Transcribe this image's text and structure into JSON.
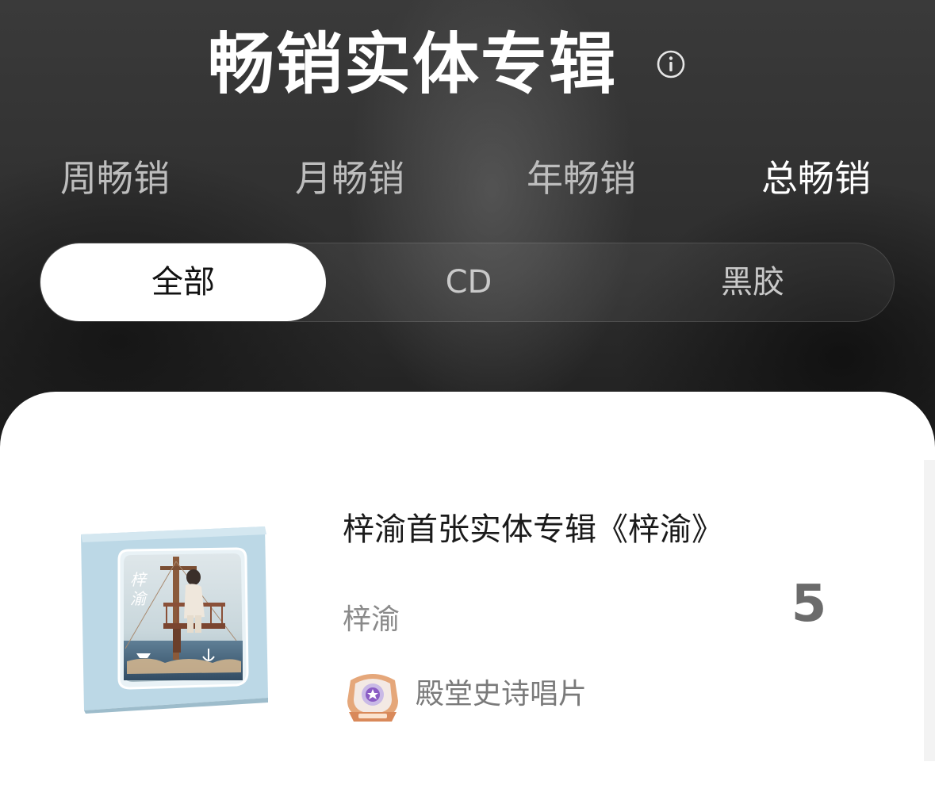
{
  "header": {
    "title": "畅销实体专辑",
    "info_icon": "info-circle-icon"
  },
  "period_tabs": [
    {
      "label": "周畅销",
      "active": false
    },
    {
      "label": "月畅销",
      "active": false
    },
    {
      "label": "年畅销",
      "active": false
    },
    {
      "label": "总畅销",
      "active": true
    }
  ],
  "format_tabs": [
    {
      "label": "全部",
      "active": true
    },
    {
      "label": "CD",
      "active": false
    },
    {
      "label": "黑胶",
      "active": false
    }
  ],
  "list": [
    {
      "title": "梓渝首张实体专辑《梓渝》",
      "artist": "梓渝",
      "rank_value": "5",
      "badge": {
        "label": "殿堂史诗唱片",
        "icon": "epic-record-badge-icon"
      },
      "cover_text": "梓渝"
    }
  ],
  "colors": {
    "header_bg": "#2e2e2e",
    "active_tab_text": "#ffffff",
    "inactive_tab_text": "#bdbdbd",
    "card_bg": "#ffffff",
    "badge_purple": "#8a5cc4",
    "badge_bronze": "#d99a6a"
  }
}
